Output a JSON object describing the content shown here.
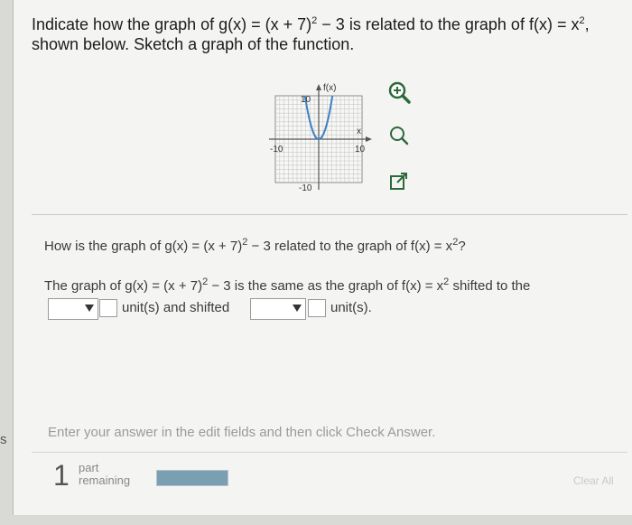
{
  "question": {
    "line1_pre": "Indicate how the graph of g(x) = (x + 7)",
    "line1_exp": "2",
    "line1_mid": " − 3 is related to the graph of f(x) = x",
    "line1_exp2": "2",
    "line1_end": ",",
    "line2": "shown below. Sketch a graph of the function."
  },
  "graph": {
    "y_label": "f(x)",
    "x_label": "x",
    "y_max_label": "10",
    "y_min_label": "-10",
    "x_min_label": "-10",
    "x_max_label": "10",
    "curve": "f(x) = x^2"
  },
  "tools": {
    "zoom_in": "magnifier-plus-icon",
    "zoom_out": "magnifier-icon",
    "popout": "popout-icon"
  },
  "prompt": {
    "pre": "How is the graph of g(x) = (x + 7)",
    "exp": "2",
    "mid": " − 3 related to the graph of f(x) = x",
    "exp2": "2",
    "end": "?"
  },
  "statement": {
    "pre": "The graph of g(x) = (x + 7)",
    "exp": "2",
    "mid": " − 3 is the same as the graph of f(x) = x",
    "exp2": "2",
    "end": " shifted to the"
  },
  "answer": {
    "units_and_shifted": "unit(s) and shifted",
    "units": "unit(s)."
  },
  "hint": "Enter your answer in the edit fields and then click Check Answer.",
  "footer": {
    "parts_count": "1",
    "parts_label_1": "part",
    "parts_label_2": "remaining",
    "progress": 1.0,
    "clear_button": "Clear All"
  },
  "edge_letter": "s"
}
